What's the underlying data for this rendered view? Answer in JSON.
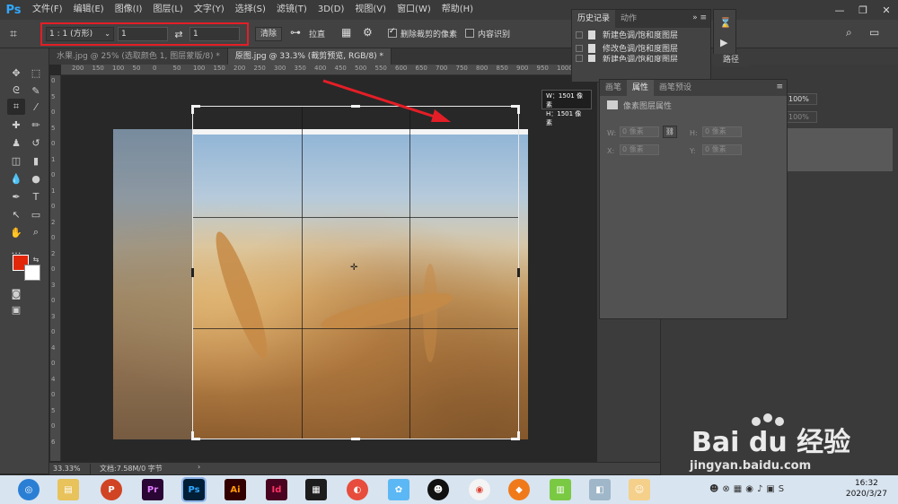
{
  "app": {
    "logo": "Ps"
  },
  "menu": [
    "文件(F)",
    "编辑(E)",
    "图像(I)",
    "图层(L)",
    "文字(Y)",
    "选择(S)",
    "滤镜(T)",
    "3D(D)",
    "视图(V)",
    "窗口(W)",
    "帮助(H)"
  ],
  "options": {
    "ratio": "1 : 1 (方形)",
    "width_value": "1",
    "height_value": "1",
    "clear_label": "清除",
    "straighten_label": "拉直",
    "delete_cropped_label": "删除裁剪的像素",
    "delete_cropped_checked": true,
    "content_aware_label": "内容识别",
    "content_aware_checked": false
  },
  "doc_tabs": [
    {
      "label": "水果.jpg @ 25% (选取颜色 1, 图层蒙版/8) *",
      "active": false
    },
    {
      "label": "原图.jpg @ 33.3% (裁剪预览, RGB/8) *",
      "active": true
    }
  ],
  "ruler_h_labels": [
    "200",
    "150",
    "100",
    "50",
    "0",
    "50",
    "100",
    "150",
    "200",
    "250",
    "300",
    "350",
    "400",
    "450",
    "500",
    "550",
    "600",
    "650",
    "700",
    "750",
    "800",
    "850",
    "900",
    "950",
    "1000",
    "1050",
    "1100"
  ],
  "ruler_v_labels": [
    "0",
    "5",
    "0",
    "5",
    "0",
    "1",
    "0",
    "1",
    "0",
    "2",
    "0",
    "2",
    "0",
    "3",
    "0",
    "3",
    "0",
    "4",
    "0",
    "4",
    "0",
    "5",
    "0",
    "6"
  ],
  "dimension_tooltip": {
    "w": "W：1501 像素",
    "h": "H：1501 像素"
  },
  "status": {
    "zoom": "33.33%",
    "doc_info": "文档:7.58M/0 字节"
  },
  "history_panel": {
    "tabs": [
      "历史记录",
      "动作"
    ],
    "items": [
      "新建色调/饱和度图层",
      "修改色调/饱和度图层",
      "新建色调/饱和度图层"
    ]
  },
  "path_tab": "路径",
  "properties_panel": {
    "tabs": [
      "画笔",
      "属性",
      "画笔预设"
    ],
    "active_tab": "属性",
    "header": "像素图层属性",
    "w_label": "W:",
    "w_placeholder": "0 像素",
    "h_label": "H:",
    "h_placeholder": "0 像素",
    "x_label": "X:",
    "x_placeholder": "0 像素",
    "y_label": "Y:",
    "y_placeholder": "0 像素"
  },
  "layers_dock": {
    "opacity": "100%",
    "fill": "100%"
  },
  "taskbar": {
    "time": "16:32",
    "date": "2020/3/27",
    "apps": [
      "Pr",
      "Ps",
      "Ai",
      "Id"
    ]
  },
  "watermark": {
    "brand": "Bai du 经验",
    "url": "jingyan.baidu.com"
  },
  "colors": {
    "foreground": "#e2260a",
    "background": "#ffffff",
    "annotation": "#e41e26",
    "ps_blue": "#31a8ff"
  }
}
